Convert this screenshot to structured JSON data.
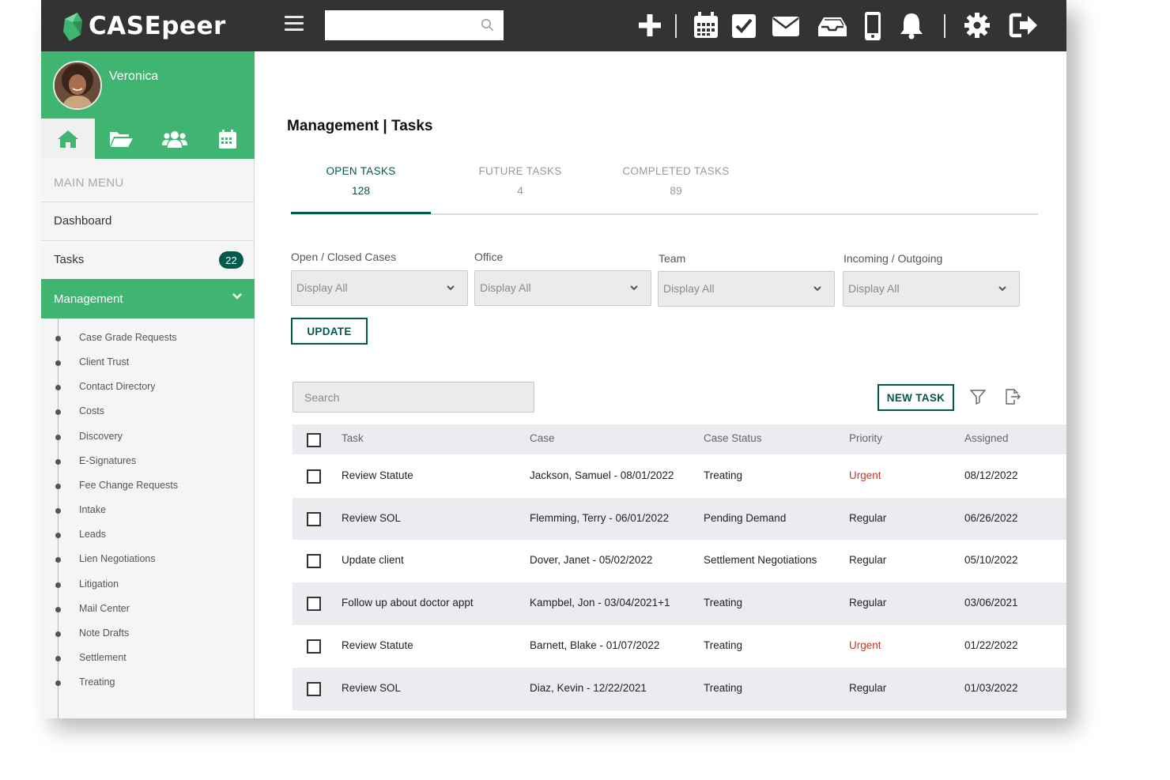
{
  "app": {
    "name": "CASEpeer"
  },
  "topbar": {
    "search_placeholder": "",
    "icons": [
      "plus-icon",
      "calendar-icon",
      "check-square-icon",
      "envelope-icon",
      "inbox-icon",
      "mobile-icon",
      "bell-icon",
      "gear-icon",
      "sign-out-icon"
    ]
  },
  "user": {
    "name": "Veronica"
  },
  "quick_tabs": [
    "home-icon",
    "folder-open-icon",
    "users-icon",
    "calendar-icon"
  ],
  "sidebar": {
    "main_menu_label": "MAIN MENU",
    "dashboard": "Dashboard",
    "tasks": {
      "label": "Tasks",
      "badge": "22"
    },
    "management": "Management",
    "submenu": [
      "Case Grade Requests",
      "Client Trust",
      "Contact Directory",
      "Costs",
      "Discovery",
      "E-Signatures",
      "Fee Change Requests",
      "Intake",
      "Leads",
      "Lien Negotiations",
      "Litigation",
      "Mail Center",
      "Note Drafts",
      "Settlement",
      "Treating"
    ]
  },
  "page": {
    "title": "Management | Tasks",
    "tabs": [
      {
        "label": "OPEN TASKS",
        "count": "128"
      },
      {
        "label": "FUTURE TASKS",
        "count": "4"
      },
      {
        "label": "COMPLETED TASKS",
        "count": "89"
      }
    ],
    "filters": [
      {
        "label": "Open / Closed Cases",
        "value": "Display All"
      },
      {
        "label": "Office",
        "value": "Display All"
      },
      {
        "label": "Team",
        "value": "Display All"
      },
      {
        "label": "Incoming / Outgoing",
        "value": "Display All"
      }
    ],
    "update_label": "UPDATE",
    "search_placeholder": "Search",
    "new_task_label": "NEW TASK"
  },
  "table": {
    "columns": [
      "Task",
      "Case",
      "Case Status",
      "Priority",
      "Assigned"
    ],
    "rows": [
      {
        "task": "Review Statute",
        "case": "Jackson, Samuel - 08/01/2022",
        "status": "Treating",
        "priority": "Urgent",
        "assigned": "08/12/2022"
      },
      {
        "task": "Review SOL",
        "case": "Flemming, Terry - 06/01/2022",
        "status": "Pending Demand",
        "priority": "Regular",
        "assigned": "06/26/2022"
      },
      {
        "task": "Update client",
        "case": "Dover, Janet - 05/02/2022",
        "status": "Settlement Negotiations",
        "priority": "Regular",
        "assigned": "05/10/2022"
      },
      {
        "task": "Follow up about doctor appt",
        "case": "Kampbel, Jon - 03/04/2021+1",
        "status": "Treating",
        "priority": "Regular",
        "assigned": "03/06/2021"
      },
      {
        "task": "Review Statute",
        "case": "Barnett, Blake - 01/07/2022",
        "status": "Treating",
        "priority": "Urgent",
        "assigned": "01/22/2022"
      },
      {
        "task": "Review SOL",
        "case": "Diaz, Kevin - 12/22/2021",
        "status": "Treating",
        "priority": "Regular",
        "assigned": "01/03/2022"
      }
    ]
  },
  "colors": {
    "brand_green": "#3fb571",
    "dark_teal": "#00594a",
    "topbar": "#333333",
    "urgent": "#c0392b"
  }
}
